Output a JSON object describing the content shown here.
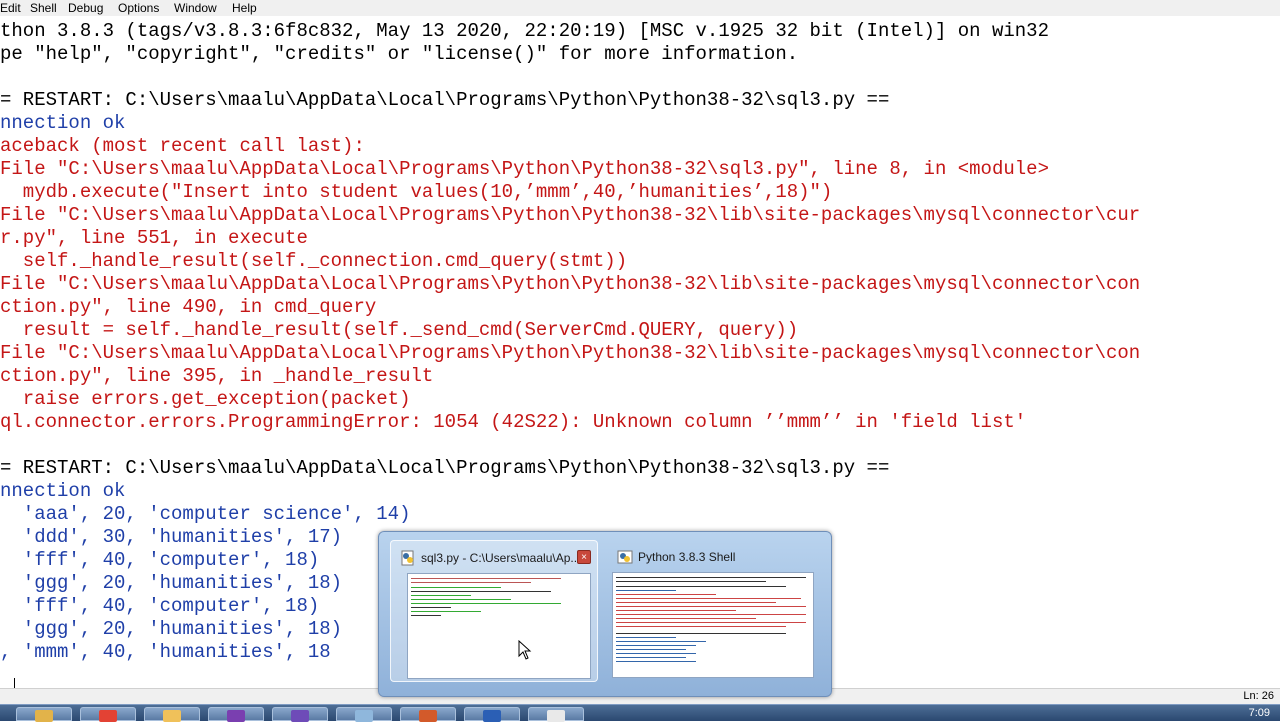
{
  "menubar": {
    "items": [
      "Edit",
      "Shell",
      "Debug",
      "Options",
      "Window",
      "Help"
    ]
  },
  "shell": {
    "lines": [
      {
        "text": "thon 3.8.3 (tags/v3.8.3:6f8c832, May 13 2020, 22:20:19) [MSC v.1925 32 bit (Intel)] on win32",
        "color": "black"
      },
      {
        "text": "pe \"help\", \"copyright\", \"credits\" or \"license()\" for more information.",
        "color": "black"
      },
      {
        "text": "",
        "color": "black"
      },
      {
        "text": "= RESTART: C:\\Users\\maalu\\AppData\\Local\\Programs\\Python\\Python38-32\\sql3.py ==",
        "color": "black"
      },
      {
        "text": "nnection ok",
        "color": "blue"
      },
      {
        "text": "aceback (most recent call last):",
        "color": "red"
      },
      {
        "text": "File \"C:\\Users\\maalu\\AppData\\Local\\Programs\\Python\\Python38-32\\sql3.py\", line 8, in <module>",
        "color": "red"
      },
      {
        "text": "  mydb.execute(\"Insert into student values(10,’mmm’,40,’humanities’,18)\")",
        "color": "red"
      },
      {
        "text": "File \"C:\\Users\\maalu\\AppData\\Local\\Programs\\Python\\Python38-32\\lib\\site-packages\\mysql\\connector\\cur",
        "color": "red"
      },
      {
        "text": "r.py\", line 551, in execute",
        "color": "red"
      },
      {
        "text": "  self._handle_result(self._connection.cmd_query(stmt))",
        "color": "red"
      },
      {
        "text": "File \"C:\\Users\\maalu\\AppData\\Local\\Programs\\Python\\Python38-32\\lib\\site-packages\\mysql\\connector\\con",
        "color": "red"
      },
      {
        "text": "ction.py\", line 490, in cmd_query",
        "color": "red"
      },
      {
        "text": "  result = self._handle_result(self._send_cmd(ServerCmd.QUERY, query))",
        "color": "red"
      },
      {
        "text": "File \"C:\\Users\\maalu\\AppData\\Local\\Programs\\Python\\Python38-32\\lib\\site-packages\\mysql\\connector\\con",
        "color": "red"
      },
      {
        "text": "ction.py\", line 395, in _handle_result",
        "color": "red"
      },
      {
        "text": "  raise errors.get_exception(packet)",
        "color": "red"
      },
      {
        "text": "ql.connector.errors.ProgrammingError: 1054 (42S22): Unknown column ’’mmm’’ in 'field list'",
        "color": "red"
      },
      {
        "text": "",
        "color": "black"
      },
      {
        "text": "= RESTART: C:\\Users\\maalu\\AppData\\Local\\Programs\\Python\\Python38-32\\sql3.py ==",
        "color": "black"
      },
      {
        "text": "nnection ok",
        "color": "blue"
      },
      {
        "text": "  'aaa', 20, 'computer science', 14)",
        "color": "blue"
      },
      {
        "text": "  'ddd', 30, 'humanities', 17)",
        "color": "blue"
      },
      {
        "text": "  'fff', 40, 'computer', 18)",
        "color": "blue"
      },
      {
        "text": "  'ggg', 20, 'humanities', 18)",
        "color": "blue"
      },
      {
        "text": "  'fff', 40, 'computer', 18)",
        "color": "blue"
      },
      {
        "text": "  'ggg', 20, 'humanities', 18)",
        "color": "blue"
      },
      {
        "text": ", 'mmm', 40, 'humanities', 18",
        "color": "blue"
      }
    ]
  },
  "statusbar": {
    "position": "Ln: 26"
  },
  "taskbar": {
    "clock": "7:09",
    "buttons": [
      {
        "icon": "windows-explorer-icon",
        "color": "#e2b34a"
      },
      {
        "icon": "chrome-icon",
        "color": "#e34234"
      },
      {
        "icon": "folder-icon",
        "color": "#f0c15a"
      },
      {
        "icon": "media-icon",
        "color": "#7a3fb0"
      },
      {
        "icon": "visual-studio-icon",
        "color": "#6e4bb8"
      },
      {
        "icon": "notepad-icon",
        "color": "#8fb7dc"
      },
      {
        "icon": "powerpoint-icon",
        "color": "#d35a2a"
      },
      {
        "icon": "word-icon",
        "color": "#2b5fb5"
      },
      {
        "icon": "python-icon",
        "color": "#e9e9e9"
      }
    ]
  },
  "popup": {
    "thumbs": [
      {
        "title": "sql3.py - C:\\Users\\maalu\\Ap...",
        "close": "×"
      },
      {
        "title": "Python 3.8.3 Shell"
      }
    ]
  }
}
